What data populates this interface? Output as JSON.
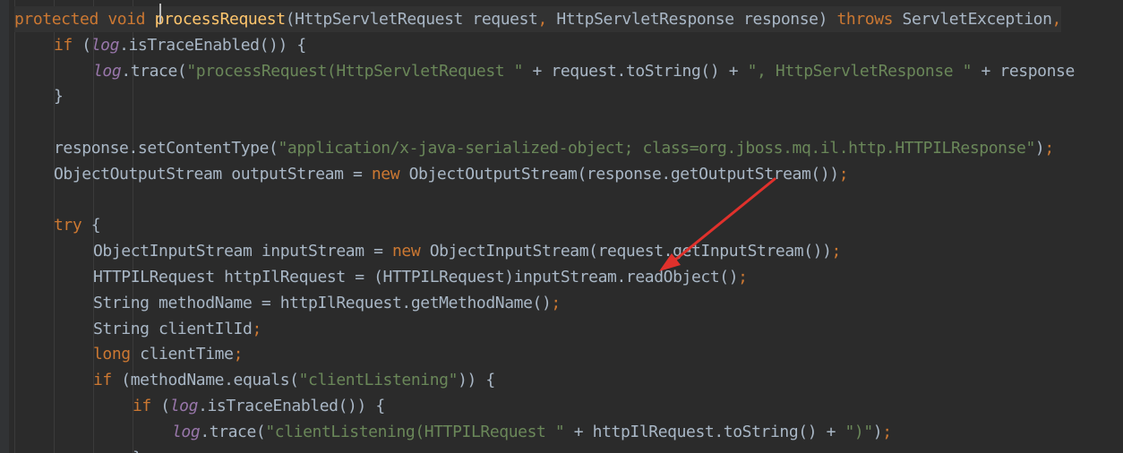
{
  "editor": {
    "colors": {
      "background": "#2b2b2b",
      "keyword": "#cc7832",
      "method_declaration": "#ffc66d",
      "field": "#9876aa",
      "string": "#6a8759",
      "plain": "#a9b7c6",
      "arrow": "#e0312c"
    },
    "lines": [
      {
        "indent": 0,
        "tokens": [
          {
            "t": "protected",
            "c": "kw"
          },
          {
            "t": " "
          },
          {
            "t": "void",
            "c": "kw"
          },
          {
            "t": " "
          },
          {
            "t": "processRequest",
            "c": "fn"
          },
          {
            "t": "(HttpServletRequest request"
          },
          {
            "t": ",",
            "c": "kw"
          },
          {
            "t": " HttpServletResponse response) "
          },
          {
            "t": "throws",
            "c": "kw"
          },
          {
            "t": " ServletException"
          },
          {
            "t": ",",
            "c": "kw"
          }
        ]
      },
      {
        "indent": 1,
        "tokens": [
          {
            "t": "if",
            "c": "kw"
          },
          {
            "t": " ("
          },
          {
            "t": "log",
            "c": "fld"
          },
          {
            "t": ".isTraceEnabled()) {"
          }
        ]
      },
      {
        "indent": 2,
        "tokens": [
          {
            "t": "log",
            "c": "fld"
          },
          {
            "t": ".trace("
          },
          {
            "t": "\"processRequest(HttpServletRequest \"",
            "c": "str"
          },
          {
            "t": " + request.toString() + "
          },
          {
            "t": "\", HttpServletResponse \"",
            "c": "str"
          },
          {
            "t": " + response"
          }
        ]
      },
      {
        "indent": 1,
        "tokens": [
          {
            "t": "}"
          }
        ]
      },
      {
        "indent": 0,
        "tokens": []
      },
      {
        "indent": 1,
        "tokens": [
          {
            "t": "response.setContentType("
          },
          {
            "t": "\"application/x-java-serialized-object; class=org.jboss.mq.il.http.HTTPILResponse\"",
            "c": "str"
          },
          {
            "t": ")"
          },
          {
            "t": ";",
            "c": "kw"
          }
        ]
      },
      {
        "indent": 1,
        "tokens": [
          {
            "t": "ObjectOutputStream outputStream = "
          },
          {
            "t": "new",
            "c": "kw"
          },
          {
            "t": " ObjectOutputStream(response.getOutputStream())"
          },
          {
            "t": ";",
            "c": "kw"
          }
        ]
      },
      {
        "indent": 0,
        "tokens": []
      },
      {
        "indent": 1,
        "tokens": [
          {
            "t": "try",
            "c": "kw"
          },
          {
            "t": " {"
          }
        ]
      },
      {
        "indent": 2,
        "tokens": [
          {
            "t": "ObjectInputStream inputStream = "
          },
          {
            "t": "new",
            "c": "kw"
          },
          {
            "t": " ObjectInputStream(request.getInputStream())"
          },
          {
            "t": ";",
            "c": "kw"
          }
        ]
      },
      {
        "indent": 2,
        "tokens": [
          {
            "t": "HTTPILRequest httpIlRequest = (HTTPILRequest)inputStream.readObject()"
          },
          {
            "t": ";",
            "c": "kw"
          }
        ]
      },
      {
        "indent": 2,
        "tokens": [
          {
            "t": "String methodName = httpIlRequest.getMethodName()"
          },
          {
            "t": ";",
            "c": "kw"
          }
        ]
      },
      {
        "indent": 2,
        "tokens": [
          {
            "t": "String clientIlId"
          },
          {
            "t": ";",
            "c": "kw"
          }
        ]
      },
      {
        "indent": 2,
        "tokens": [
          {
            "t": "long",
            "c": "kw"
          },
          {
            "t": " clientTime"
          },
          {
            "t": ";",
            "c": "kw"
          }
        ]
      },
      {
        "indent": 2,
        "tokens": [
          {
            "t": "if",
            "c": "kw"
          },
          {
            "t": " (methodName.equals("
          },
          {
            "t": "\"clientListening\"",
            "c": "str"
          },
          {
            "t": ")) {"
          }
        ]
      },
      {
        "indent": 3,
        "tokens": [
          {
            "t": "if",
            "c": "kw"
          },
          {
            "t": " ("
          },
          {
            "t": "log",
            "c": "fld"
          },
          {
            "t": ".isTraceEnabled()) {"
          }
        ]
      },
      {
        "indent": 4,
        "tokens": [
          {
            "t": "log",
            "c": "fld"
          },
          {
            "t": ".trace("
          },
          {
            "t": "\"clientListening(HTTPILRequest \"",
            "c": "str"
          },
          {
            "t": " + httpIlRequest.toString() + "
          },
          {
            "t": "\")\"",
            "c": "str"
          },
          {
            "t": ")"
          },
          {
            "t": ";",
            "c": "kw"
          }
        ]
      },
      {
        "indent": 3,
        "tokens": [
          {
            "t": "}"
          }
        ]
      }
    ]
  }
}
